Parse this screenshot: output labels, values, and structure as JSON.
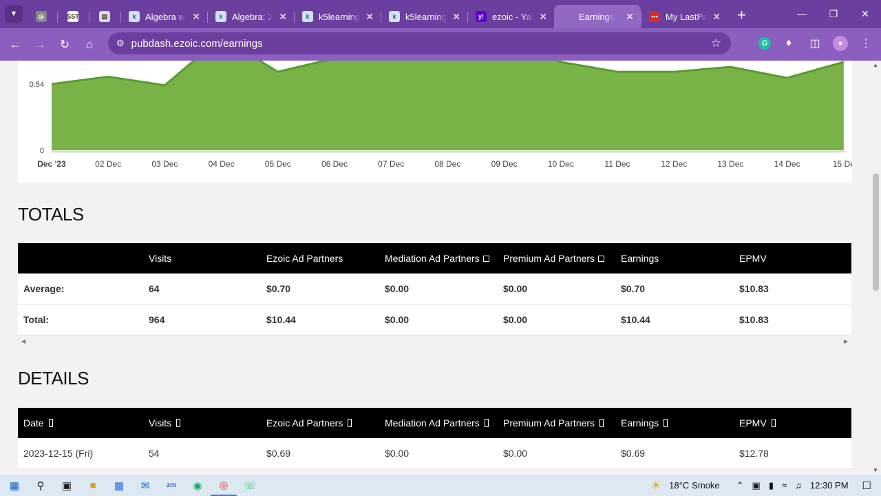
{
  "browser": {
    "tabs": [
      {
        "title": "",
        "icon": "pinned-app-icon",
        "pinned": true
      },
      {
        "title": "",
        "icon": "sst-icon",
        "pinned": true
      },
      {
        "title": "",
        "icon": "calculator-icon",
        "pinned": true
      },
      {
        "title": "Algebra w",
        "icon": "k5-icon"
      },
      {
        "title": "Algebra: 2",
        "icon": "k5-icon"
      },
      {
        "title": "k5learning",
        "icon": "k5-icon"
      },
      {
        "title": "k5learning",
        "icon": "k5-icon"
      },
      {
        "title": "ezoic - Yal",
        "icon": "yahoo-icon"
      },
      {
        "title": "Earnings",
        "icon": "ezoic-icon",
        "active": true
      },
      {
        "title": "My LastPa",
        "icon": "lastpass-icon"
      }
    ],
    "url": "pubdash.ezoic.com/earnings",
    "theme_color": "#8a5fbf"
  },
  "chart_data": {
    "type": "area",
    "x": [
      "Dec '23",
      "02 Dec",
      "03 Dec",
      "04 Dec",
      "05 Dec",
      "06 Dec",
      "07 Dec",
      "08 Dec",
      "09 Dec",
      "10 Dec",
      "11 Dec",
      "12 Dec",
      "13 Dec",
      "14 Dec",
      "15 De"
    ],
    "values": [
      0.54,
      0.6,
      0.53,
      0.92,
      0.64,
      0.75,
      1.08,
      1.0,
      0.95,
      0.72,
      0.64,
      0.64,
      0.68,
      0.59,
      0.72
    ],
    "yticks": [
      "0",
      "0.54"
    ],
    "ylim": [
      0,
      0.92
    ],
    "fill_color": "#79b347",
    "line_color": "#5a9a30"
  },
  "totals": {
    "title": "TOTALS",
    "headers": [
      "",
      "Visits",
      "Ezoic Ad Partners",
      "Mediation Ad Partners",
      "Premium Ad Partners",
      "Earnings",
      "EPMV"
    ],
    "rows": [
      [
        "Average:",
        "64",
        "$0.70",
        "$0.00",
        "$0.00",
        "$0.70",
        "$10.83"
      ],
      [
        "Total:",
        "964",
        "$10.44",
        "$0.00",
        "$0.00",
        "$10.44",
        "$10.83"
      ]
    ]
  },
  "details": {
    "title": "DETAILS",
    "headers": [
      "Date",
      "Visits",
      "Ezoic Ad Partners",
      "Mediation Ad Partners",
      "Premium Ad Partners",
      "Earnings",
      "EPMV"
    ],
    "rows": [
      [
        "2023-12-15 (Fri)",
        "54",
        "$0.69",
        "$0.00",
        "$0.00",
        "$0.69",
        "$12.78"
      ]
    ]
  },
  "taskbar": {
    "weather_temp": "18°C",
    "weather_text": "Smoke",
    "time": "12:30 PM"
  }
}
